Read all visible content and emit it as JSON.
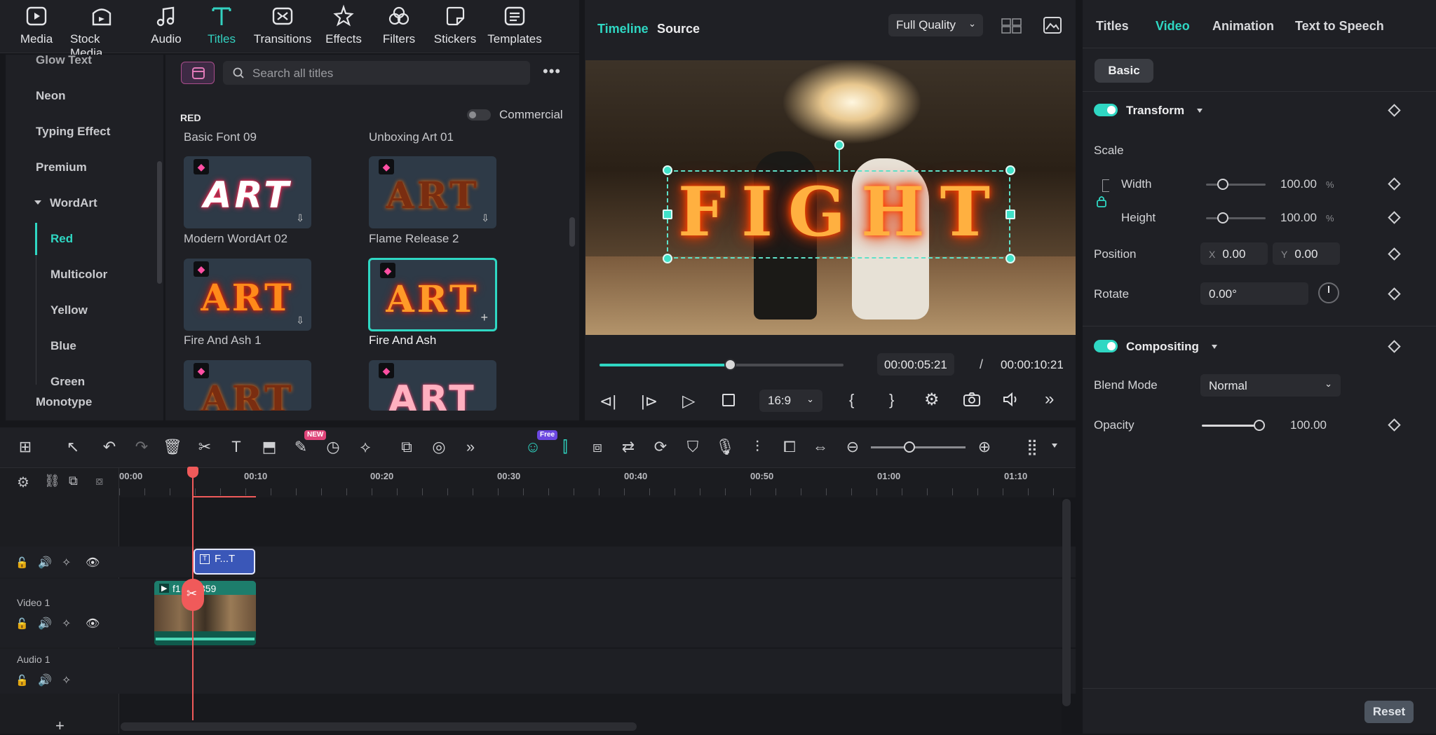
{
  "toolbar": {
    "items": [
      {
        "label": "Media",
        "icon": "media-icon"
      },
      {
        "label": "Stock Media",
        "icon": "stock-media-icon"
      },
      {
        "label": "Audio",
        "icon": "music-note-icon"
      },
      {
        "label": "Titles",
        "icon": "titles-t-icon"
      },
      {
        "label": "Transitions",
        "icon": "transitions-icon"
      },
      {
        "label": "Effects",
        "icon": "effects-star-icon"
      },
      {
        "label": "Filters",
        "icon": "filters-icon"
      },
      {
        "label": "Stickers",
        "icon": "stickers-icon"
      },
      {
        "label": "Templates",
        "icon": "templates-icon"
      }
    ],
    "active": "Titles"
  },
  "categories": {
    "items": [
      "Glow Text",
      "Neon",
      "Typing Effect",
      "Premium",
      "WordArt",
      "Red",
      "Multicolor",
      "Yellow",
      "Blue",
      "Green",
      "Monotype"
    ],
    "active": "Red"
  },
  "titles": {
    "search_placeholder": "Search all titles",
    "section": "RED",
    "commercial_label": "Commercial",
    "thumb_text": "ART",
    "items": [
      {
        "label": "Basic Font 09"
      },
      {
        "label": "Unboxing Art 01"
      },
      {
        "label": "Modern WordArt 02"
      },
      {
        "label": "Flame Release 2"
      },
      {
        "label": "Fire And Ash 1"
      },
      {
        "label": "Fire And Ash"
      }
    ],
    "selected": "Fire And Ash"
  },
  "preview": {
    "tabs": [
      "Timeline",
      "Source"
    ],
    "active_tab": "Timeline",
    "quality": "Full Quality",
    "overlay_text": "FIGHT",
    "current_time": "00:00:05:21",
    "separator": "/",
    "total_time": "00:00:10:21",
    "aspect": "16:9",
    "progress": 0.53,
    "bracket_in": "{",
    "bracket_out": "}"
  },
  "inspector": {
    "tabs": [
      "Titles",
      "Video",
      "Animation",
      "Text to Speech"
    ],
    "active_tab": "Video",
    "subtab": "Basic",
    "transform": {
      "title": "Transform",
      "scale_label": "Scale",
      "width_label": "Width",
      "width_value": "100.00",
      "height_label": "Height",
      "height_value": "100.00",
      "unit": "%",
      "position_label": "Position",
      "x_label": "X",
      "x_value": "0.00",
      "y_label": "Y",
      "y_value": "0.00",
      "rotate_label": "Rotate",
      "rotate_value": "0.00°"
    },
    "compositing": {
      "title": "Compositing",
      "blend_label": "Blend Mode",
      "blend_value": "Normal",
      "opacity_label": "Opacity",
      "opacity_value": "100.00"
    },
    "reset_label": "Reset"
  },
  "timeline": {
    "ruler": [
      "00:00",
      "00:10",
      "00:20",
      "00:30",
      "00:40",
      "00:50",
      "01:00",
      "01:10"
    ],
    "tracks": [
      {
        "label": ""
      },
      {
        "label": "Video 1"
      },
      {
        "label": "Audio 1"
      }
    ],
    "title_clip_label": "F...T",
    "video_clip_label": "f1...72859",
    "add_track": "+",
    "new_badge": "NEW",
    "free_badge": "Free"
  },
  "colors": {
    "accent": "#2fd7c3",
    "playhead": "#f05a5a",
    "title_clip": "#3a57b8",
    "video_clip": "#1d7d6c"
  }
}
